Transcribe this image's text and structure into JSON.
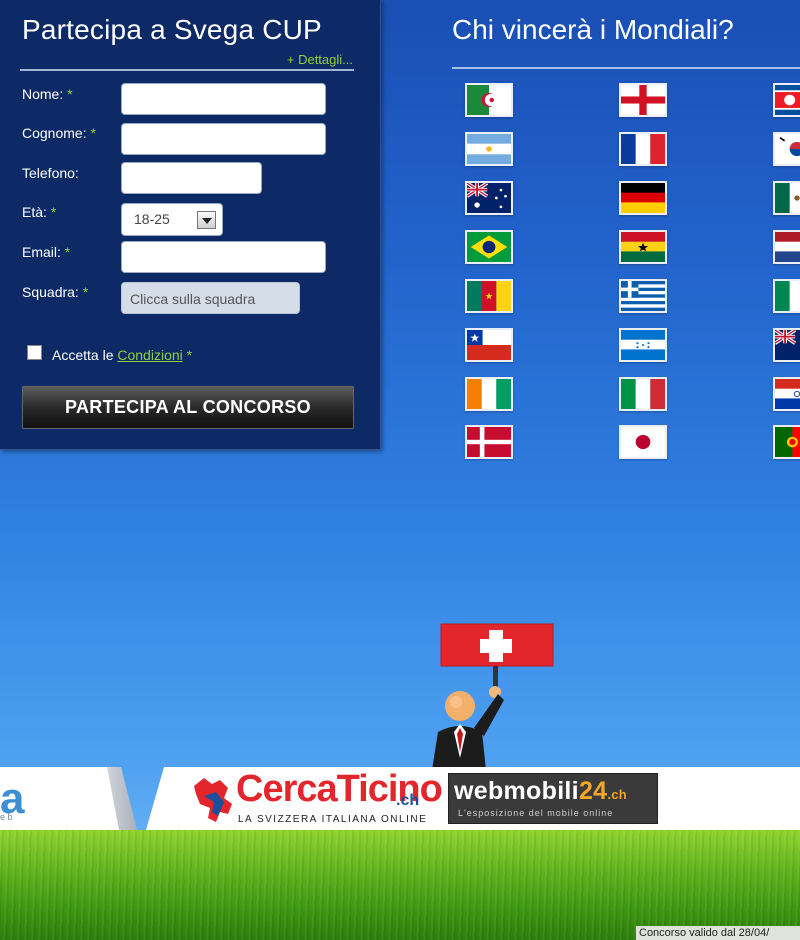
{
  "form": {
    "title": "Partecipa a Svega CUP",
    "details_link": "+ Dettagli...",
    "fields": {
      "nome": {
        "label": "Nome:",
        "required_mark": "*",
        "value": ""
      },
      "cognome": {
        "label": "Cognome:",
        "required_mark": "*",
        "value": ""
      },
      "telefono": {
        "label": "Telefono:",
        "value": ""
      },
      "eta": {
        "label": "Età:",
        "required_mark": "*",
        "selected": "18-25"
      },
      "email": {
        "label": "Email:",
        "required_mark": "*",
        "value": ""
      },
      "squadra": {
        "label": "Squadra:",
        "required_mark": "*",
        "button_label": "Clicca sulla squadra"
      }
    },
    "accept": {
      "prefix": "Accetta le",
      "link": "Condizioni",
      "required_mark": "*"
    },
    "submit_label": "PARTECIPA AL CONCORSO"
  },
  "world_cup": {
    "title": "Chi vincerà i Mondiali?",
    "flags": [
      "algeria-flag",
      "england-flag",
      "north-korea-flag",
      "argentina-flag",
      "france-flag",
      "south-korea-flag",
      "australia-flag",
      "germany-flag",
      "mexico-flag",
      "brazil-flag",
      "ghana-flag",
      "netherlands-flag",
      "cameroon-flag",
      "greece-flag",
      "nigeria-flag",
      "chile-flag",
      "honduras-flag",
      "new-zealand-flag",
      "ivory-coast-flag",
      "italy-flag",
      "paraguay-flag",
      "denmark-flag",
      "japan-flag",
      "portugal-flag"
    ]
  },
  "sponsors": {
    "left_partial": "a",
    "left_partial_tag": "e b",
    "cercaticino": {
      "name": "CercaTicino",
      "suffix": ".ch",
      "tagline": "LA SVIZZERA ITALIANA ONLINE"
    },
    "webmobili": {
      "name": "webmobili",
      "number": "24",
      "suffix": ".ch",
      "tagline": "L'esposizione del mobile online"
    }
  },
  "footer_note": "Concorso valido dal 28/04/",
  "colors": {
    "accent_green": "#8fd13a",
    "panel_bg": "#0d2a66",
    "swiss_red": "#e3262c"
  }
}
